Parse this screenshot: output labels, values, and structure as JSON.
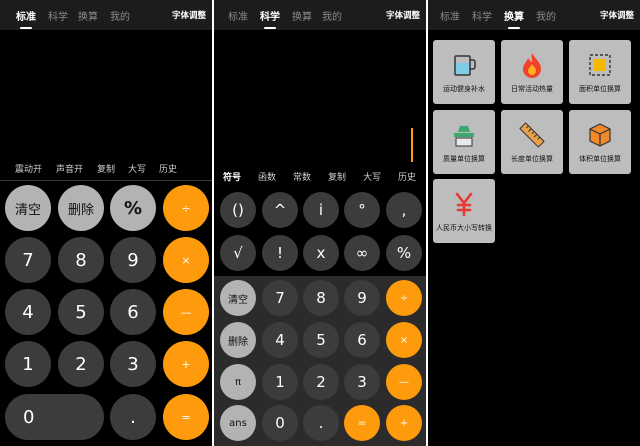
{
  "tabs": [
    "标准",
    "科学",
    "换算",
    "我的"
  ],
  "font_adjust": "字体调整",
  "standard": {
    "options": [
      "震动开",
      "声音开",
      "复制",
      "大写",
      "历史"
    ],
    "rows": [
      [
        "清空",
        "删除",
        "%",
        "÷"
      ],
      [
        "7",
        "8",
        "9",
        "×"
      ],
      [
        "4",
        "5",
        "6",
        "—"
      ],
      [
        "1",
        "2",
        "3",
        "+"
      ],
      [
        "0",
        ".",
        "="
      ]
    ]
  },
  "scientific": {
    "options": [
      "符号",
      "函数",
      "常数",
      "复制",
      "大写",
      "历史"
    ],
    "func_rows": [
      [
        "()",
        "^",
        "i",
        "°",
        ","
      ],
      [
        "√",
        "!",
        "x",
        "∞",
        "%"
      ]
    ],
    "rows": [
      [
        "清空",
        "7",
        "8",
        "9",
        "÷"
      ],
      [
        "删除",
        "4",
        "5",
        "6",
        "×"
      ],
      [
        "π",
        "1",
        "2",
        "3",
        "—"
      ],
      [
        "ans",
        "0",
        ".",
        "=",
        "+"
      ]
    ]
  },
  "conversion": {
    "tiles": [
      "运动健身补水",
      "日常活动热量",
      "面积单位换算",
      "质量单位换算",
      "长度单位换算",
      "体积单位换算",
      "人民币大小写转换"
    ],
    "icons": [
      "cup-icon",
      "flame-icon",
      "area-icon",
      "scale-icon",
      "ruler-icon",
      "cube-icon",
      "yuan-icon"
    ]
  },
  "colors": {
    "accent": "#fe9b0c",
    "key_dark": "#3c3c3c",
    "key_light": "#b3b3b3",
    "tile": "#bdbdbd"
  }
}
